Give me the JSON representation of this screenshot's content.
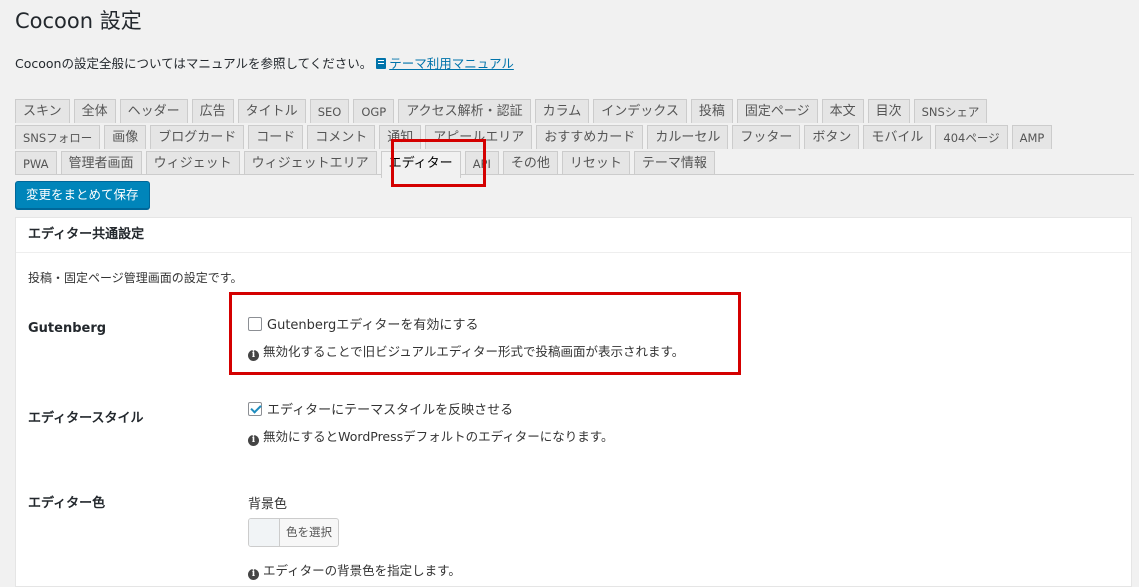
{
  "page": {
    "title": "Cocoon 設定",
    "intro_text": "Cocoonの設定全般についてはマニュアルを参照してください。",
    "manual_link": "テーマ利用マニュアル"
  },
  "tabs": {
    "row1": [
      "スキン",
      "全体",
      "ヘッダー",
      "広告",
      "タイトル",
      "SEO",
      "OGP",
      "アクセス解析・認証",
      "カラム",
      "インデックス",
      "投稿",
      "固定ページ",
      "本文",
      "目次",
      "SNSシェア"
    ],
    "row2": [
      "SNSフォロー",
      "画像",
      "ブログカード",
      "コード",
      "コメント",
      "通知",
      "アピールエリア",
      "おすすめカード",
      "カルーセル",
      "フッター",
      "ボタン",
      "モバイル",
      "404ページ",
      "AMP"
    ],
    "row3": [
      "PWA",
      "管理者画面",
      "ウィジェット",
      "ウィジェットエリア",
      "エディター",
      "API",
      "その他",
      "リセット",
      "テーマ情報"
    ],
    "active": "エディター"
  },
  "save_button": "変更をまとめて保存",
  "panel": {
    "title": "エディター共通設定",
    "description": "投稿・固定ページ管理画面の設定です。",
    "gutenberg": {
      "label": "Gutenberg",
      "checkbox_label": "Gutenbergエディターを有効にする",
      "checked": false,
      "note": "無効化することで旧ビジュアルエディター形式で投稿画面が表示されます。"
    },
    "editor_style": {
      "label": "エディタースタイル",
      "checkbox_label": "エディターにテーマスタイルを反映させる",
      "checked": true,
      "note": "無効にするとWordPressデフォルトのエディターになります。"
    },
    "editor_color": {
      "label": "エディター色",
      "sub_label": "背景色",
      "button_label": "色を選択",
      "note": "エディターの背景色を指定します。"
    }
  },
  "colors": {
    "primary_button": "#0085ba",
    "link": "#0073aa",
    "highlight": "#d40000"
  },
  "icons": [
    "book-icon",
    "info-icon",
    "checkbox-icon"
  ]
}
